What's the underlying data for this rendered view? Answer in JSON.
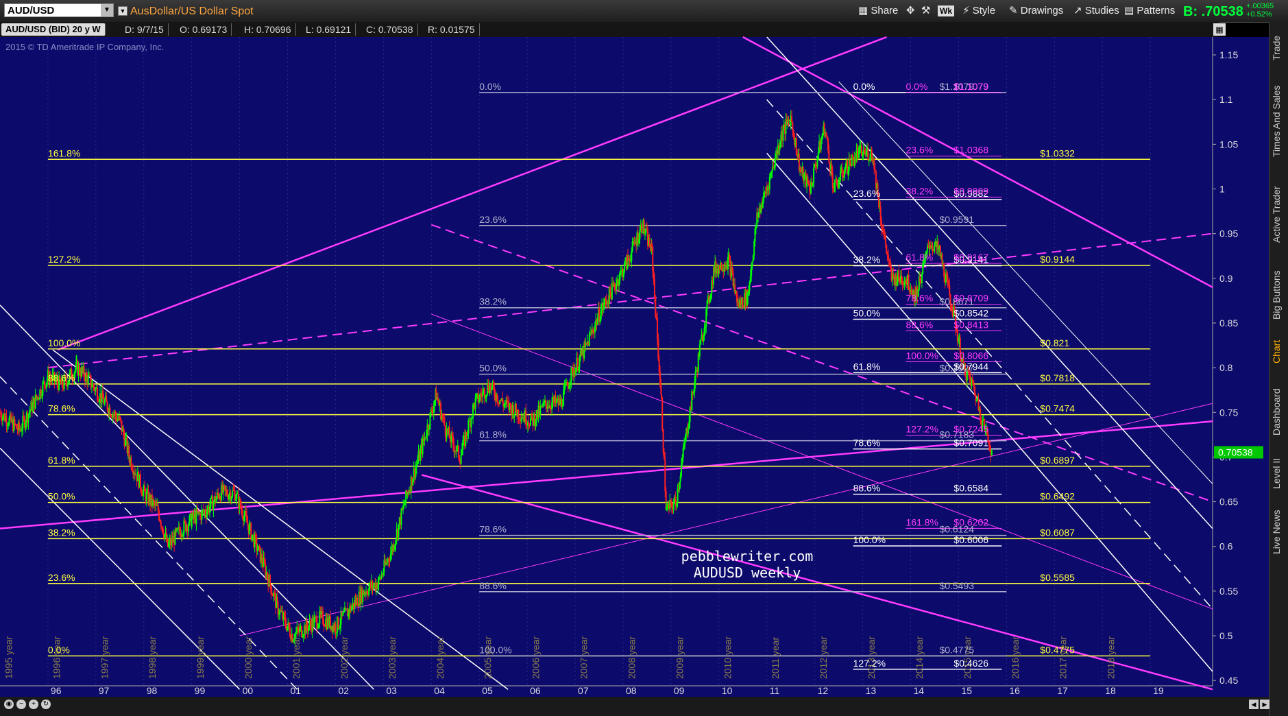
{
  "header": {
    "symbol": "AUD/USD",
    "description": "AusDollar/US Dollar Spot",
    "toolbar": [
      "Share",
      "Wk",
      "Style",
      "Drawings",
      "Studies",
      "Patterns"
    ],
    "bid_label": "B: .70538",
    "change_abs": "+.00365",
    "change_pct": "+0.52%"
  },
  "infobar": {
    "series": "AUD/USD (BID) 20 y W",
    "date": "D: 9/7/15",
    "open": "O: 0.69173",
    "high": "H: 0.70696",
    "low": "L: 0.69121",
    "close": "C: 0.70538",
    "range": "R: 0.01575"
  },
  "copyright": "2015 © TD Ameritrade IP Company, Inc.",
  "right_tabs": [
    "Trade",
    "Times And Sales",
    "Active Trader",
    "Big Buttons",
    "Chart",
    "Dashboard",
    "Level II",
    "Live News"
  ],
  "active_tab": "Chart",
  "colors": {
    "background": "#0c0a6a",
    "candle_up": "#00ff00",
    "candle_down": "#ff2020",
    "fib_yellow": "#ffff40",
    "fib_magenta": "#ff3cff",
    "fib_white": "#ffffff",
    "price_tag": "#00c800"
  },
  "chart_data": {
    "type": "candlestick",
    "frequency": "weekly",
    "x_axis_years": [
      "96",
      "97",
      "98",
      "99",
      "00",
      "01",
      "02",
      "03",
      "04",
      "05",
      "06",
      "07",
      "08",
      "09",
      "10",
      "11",
      "12",
      "13",
      "14",
      "15",
      "16",
      "17",
      "18",
      "19"
    ],
    "year_labels": [
      "1995 year",
      "1996 year",
      "1997 year",
      "1998 year",
      "1999 year",
      "2000 year",
      "2001 year",
      "2002 year",
      "2003 year",
      "2004 year",
      "2005 year",
      "2006 year",
      "2007 year",
      "2008 year",
      "2009 year",
      "2010 year",
      "2011 year",
      "2012 year",
      "2013 year",
      "2014 year",
      "2015 year",
      "2016 year",
      "2017 year",
      "2018 year"
    ],
    "y_ticks": [
      1.15,
      1.1,
      1.05,
      1,
      0.95,
      0.9,
      0.85,
      0.8,
      0.75,
      0.7,
      0.65,
      0.6,
      0.55,
      0.5,
      0.45
    ],
    "y_tick_labels": [
      "1.15",
      "1.1",
      "1.05",
      "1",
      "0.95",
      "0.9",
      "0.85",
      "0.8",
      "0.75",
      "0.7",
      "0.65",
      "0.6",
      "0.55",
      "0.5",
      "0.45"
    ],
    "ylim": [
      0.444,
      1.17
    ],
    "xlim": [
      1995.0,
      2020.3
    ],
    "last_price": 0.7053,
    "last_price_label": "0.70538",
    "price_path": [
      [
        1995.0,
        0.75
      ],
      [
        1995.4,
        0.73
      ],
      [
        1995.7,
        0.76
      ],
      [
        1996.0,
        0.79
      ],
      [
        1996.3,
        0.78
      ],
      [
        1996.6,
        0.8
      ],
      [
        1996.8,
        0.79
      ],
      [
        1997.2,
        0.76
      ],
      [
        1997.5,
        0.74
      ],
      [
        1997.7,
        0.7
      ],
      [
        1998.0,
        0.66
      ],
      [
        1998.3,
        0.64
      ],
      [
        1998.5,
        0.6
      ],
      [
        1998.8,
        0.62
      ],
      [
        1999.0,
        0.63
      ],
      [
        1999.3,
        0.64
      ],
      [
        1999.6,
        0.66
      ],
      [
        1999.9,
        0.66
      ],
      [
        2000.2,
        0.62
      ],
      [
        2000.5,
        0.58
      ],
      [
        2000.8,
        0.53
      ],
      [
        2001.1,
        0.5
      ],
      [
        2001.4,
        0.51
      ],
      [
        2001.7,
        0.52
      ],
      [
        2002.0,
        0.51
      ],
      [
        2002.3,
        0.53
      ],
      [
        2002.6,
        0.55
      ],
      [
        2002.9,
        0.56
      ],
      [
        2003.2,
        0.6
      ],
      [
        2003.5,
        0.66
      ],
      [
        2003.8,
        0.71
      ],
      [
        2004.1,
        0.77
      ],
      [
        2004.3,
        0.73
      ],
      [
        2004.6,
        0.7
      ],
      [
        2004.9,
        0.76
      ],
      [
        2005.2,
        0.78
      ],
      [
        2005.5,
        0.76
      ],
      [
        2005.8,
        0.75
      ],
      [
        2006.1,
        0.74
      ],
      [
        2006.4,
        0.76
      ],
      [
        2006.7,
        0.76
      ],
      [
        2006.9,
        0.79
      ],
      [
        2007.2,
        0.82
      ],
      [
        2007.5,
        0.86
      ],
      [
        2007.8,
        0.89
      ],
      [
        2008.1,
        0.92
      ],
      [
        2008.4,
        0.96
      ],
      [
        2008.6,
        0.93
      ],
      [
        2008.8,
        0.76
      ],
      [
        2008.9,
        0.64
      ],
      [
        2009.1,
        0.65
      ],
      [
        2009.3,
        0.72
      ],
      [
        2009.6,
        0.82
      ],
      [
        2009.9,
        0.91
      ],
      [
        2010.2,
        0.92
      ],
      [
        2010.4,
        0.87
      ],
      [
        2010.6,
        0.88
      ],
      [
        2010.8,
        0.97
      ],
      [
        2011.0,
        1.0
      ],
      [
        2011.3,
        1.06
      ],
      [
        2011.5,
        1.08
      ],
      [
        2011.7,
        1.02
      ],
      [
        2011.9,
        1.0
      ],
      [
        2012.2,
        1.07
      ],
      [
        2012.4,
        1.0
      ],
      [
        2012.6,
        1.02
      ],
      [
        2012.9,
        1.04
      ],
      [
        2013.2,
        1.04
      ],
      [
        2013.4,
        0.96
      ],
      [
        2013.6,
        0.9
      ],
      [
        2013.9,
        0.9
      ],
      [
        2014.1,
        0.88
      ],
      [
        2014.4,
        0.94
      ],
      [
        2014.6,
        0.93
      ],
      [
        2014.9,
        0.86
      ],
      [
        2015.1,
        0.8
      ],
      [
        2015.3,
        0.78
      ],
      [
        2015.5,
        0.74
      ],
      [
        2015.7,
        0.7053
      ]
    ],
    "fib_levels": [
      {
        "group": "yellow",
        "value": 1.0332,
        "label": "$1.0332",
        "pct": "161.8%"
      },
      {
        "group": "yellow",
        "value": 0.9144,
        "label": "$0.9144",
        "pct": "127.2%"
      },
      {
        "group": "yellow",
        "value": 0.821,
        "label": "$0.821",
        "pct": "100.0%"
      },
      {
        "group": "yellow",
        "value": 0.7818,
        "label": "$0.7818",
        "pct": "88.6%"
      },
      {
        "group": "yellow",
        "value": 0.7474,
        "label": "$0.7474",
        "pct": "78.6%"
      },
      {
        "group": "yellow",
        "value": 0.6897,
        "label": "$0.6897",
        "pct": "61.8%"
      },
      {
        "group": "yellow",
        "value": 0.6492,
        "label": "$0.6492",
        "pct": "50.0%"
      },
      {
        "group": "yellow",
        "value": 0.6087,
        "label": "$0.6087",
        "pct": "38.2%"
      },
      {
        "group": "yellow",
        "value": 0.5585,
        "label": "$0.5585",
        "pct": "23.6%"
      },
      {
        "group": "yellow",
        "value": 0.4775,
        "label": "$0.4775",
        "pct": "0.0%"
      },
      {
        "group": "gray",
        "value": 1.1079,
        "label": "$1.1079",
        "pct": "0.0%"
      },
      {
        "group": "gray",
        "value": 0.9591,
        "label": "$0.9591",
        "pct": "23.6%"
      },
      {
        "group": "gray",
        "value": 0.8671,
        "label": "$0.8671",
        "pct": "38.2%"
      },
      {
        "group": "gray",
        "value": 0.7927,
        "label": "$0.7927",
        "pct": "50.0%"
      },
      {
        "group": "gray",
        "value": 0.7183,
        "label": "$0.7183",
        "pct": "61.8%"
      },
      {
        "group": "gray",
        "value": 0.6124,
        "label": "$0.6124",
        "pct": "78.6%"
      },
      {
        "group": "gray",
        "value": 0.5493,
        "label": "$0.5493",
        "pct": "88.6%"
      },
      {
        "group": "gray",
        "value": 0.4775,
        "label": "$0.4775",
        "pct": "100.0%"
      },
      {
        "group": "white",
        "value": 1.1079,
        "label": "$1.1079",
        "pct": "0.0%"
      },
      {
        "group": "white",
        "value": 0.9882,
        "label": "$0.9882",
        "pct": "23.6%"
      },
      {
        "group": "white",
        "value": 0.9141,
        "label": "$0.9141",
        "pct": "38.2%"
      },
      {
        "group": "white",
        "value": 0.8542,
        "label": "$0.8542",
        "pct": "50.0%"
      },
      {
        "group": "white",
        "value": 0.7944,
        "label": "$0.7944",
        "pct": "61.8%"
      },
      {
        "group": "white",
        "value": 0.7091,
        "label": "$0.7091",
        "pct": "78.6%"
      },
      {
        "group": "white",
        "value": 0.6584,
        "label": "$0.6584",
        "pct": "88.6%"
      },
      {
        "group": "white",
        "value": 0.6006,
        "label": "$0.6006",
        "pct": "100.0%"
      },
      {
        "group": "white",
        "value": 0.4626,
        "label": "$0.4626",
        "pct": "127.2%"
      },
      {
        "group": "magenta",
        "value": 1.1079,
        "label": "$1.1079",
        "pct": "0.0%"
      },
      {
        "group": "magenta",
        "value": 1.0368,
        "label": "$1.0368",
        "pct": "23.6%"
      },
      {
        "group": "magenta",
        "value": 0.9909,
        "label": "$0.9909",
        "pct": "38.2%"
      },
      {
        "group": "magenta",
        "value": 0.9167,
        "label": "$0.9167",
        "pct": "61.8%"
      },
      {
        "group": "magenta",
        "value": 0.8709,
        "label": "$0.8709",
        "pct": "78.6%"
      },
      {
        "group": "magenta",
        "value": 0.8413,
        "label": "$0.8413",
        "pct": "88.6%"
      },
      {
        "group": "magenta",
        "value": 0.8066,
        "label": "$0.8066",
        "pct": "100.0%"
      },
      {
        "group": "magenta",
        "value": 0.7245,
        "label": "$0.7245",
        "pct": "127.2%"
      },
      {
        "group": "magenta",
        "value": 0.6202,
        "label": "$0.6202",
        "pct": "161.8%"
      }
    ],
    "annotation": [
      "pebblewriter.com",
      "AUDUSD weekly"
    ]
  }
}
